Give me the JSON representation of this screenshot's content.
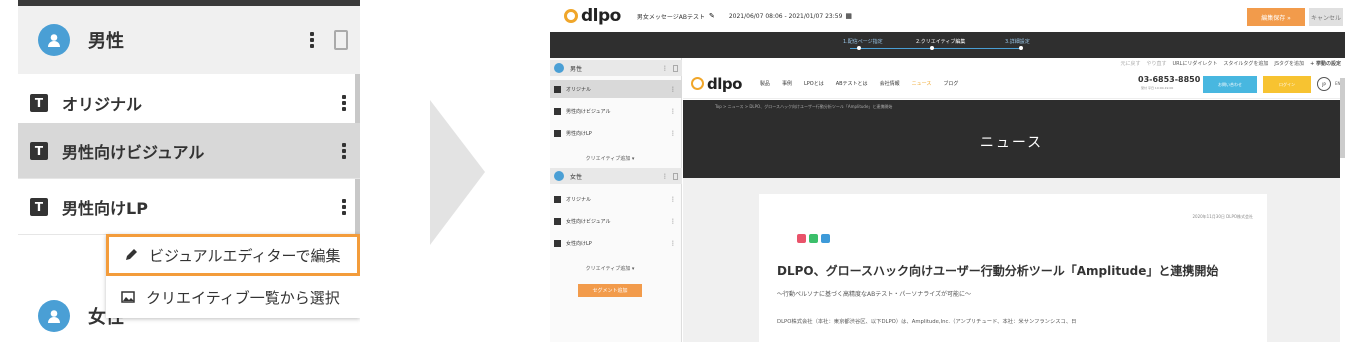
{
  "left_panel": {
    "segment_male": {
      "label": "男性"
    },
    "creatives": [
      {
        "icon_letter": "T",
        "label": "オリジナル"
      },
      {
        "icon_letter": "T",
        "label": "男性向けビジュアル"
      },
      {
        "icon_letter": "T",
        "label": "男性向けLP"
      }
    ],
    "context_menu": {
      "edit_visual": "ビジュアルエディターで編集",
      "select_from_list": "クリエイティブ一覧から選択"
    },
    "segment_female": {
      "label": "女性"
    }
  },
  "right_panel": {
    "logo": "dlpo",
    "test_name": "男女メッセージABテスト",
    "date_range": "2021/06/07 08:06 - 2021/01/07 23:59",
    "buttons": {
      "save": "編集保存 »",
      "cancel": "キャンセル"
    },
    "steps": [
      "1.配信ページ指定",
      "2.クリエイティブ編集",
      "3.詳細設定"
    ],
    "sidebar": {
      "seg1": "男性",
      "seg1_items": [
        "オリジナル",
        "男性向けビジュアル",
        "男性向けLP"
      ],
      "add_creative": "クリエイティブ追加 ▾",
      "seg2": "女性",
      "seg2_items": [
        "オリジナル",
        "女性向けビジュアル",
        "女性向けLP"
      ],
      "add_segment": "セグメント追加"
    },
    "toolbar": {
      "undo": "元に戻す",
      "redo": "やり直す",
      "url_redirect": "URLにリダイレクト",
      "add_style": "スタイルタグを追加",
      "add_script": "JSタグを追加",
      "behavior": "+ 挙動の設定"
    },
    "site": {
      "nav": [
        "製品",
        "事例",
        "LPOとは",
        "ABテストとは",
        "会社情報",
        "ニュース",
        "ブログ"
      ],
      "phone": "03-6853-8850",
      "phone_hours": "受付 平日 10:00-19:00",
      "contact": "お問い合わせ",
      "login": "ログイン",
      "lang": "JP",
      "lang_en": "EN",
      "breadcrumb": "Top > ニュース > DLPO、グロースハック向けユーザー行動分析ツール「Amplitude」と連携開始",
      "hero_title": "ニュース",
      "article_date": "2020年11月30日 DLPO株式会社",
      "article_title": "DLPO、グロースハック向けユーザー行動分析ツール「Amplitude」と連携開始",
      "article_subtitle": "〜行動ペルソナに基づく高精度なABテスト・パーソナライズが可能に〜",
      "article_body": "DLPO株式会社（本社：東京都渋谷区、以下DLPO）は、Amplitude,Inc.（アンプリチュード、本社：米サンフランシスコ、日"
    }
  },
  "colors": {
    "accent_orange": "#f29b4b",
    "segment_blue": "#4a9fd5",
    "highlight_border": "#f39c3b",
    "login_yellow": "#f7c331",
    "contact_blue": "#48b7e0"
  }
}
